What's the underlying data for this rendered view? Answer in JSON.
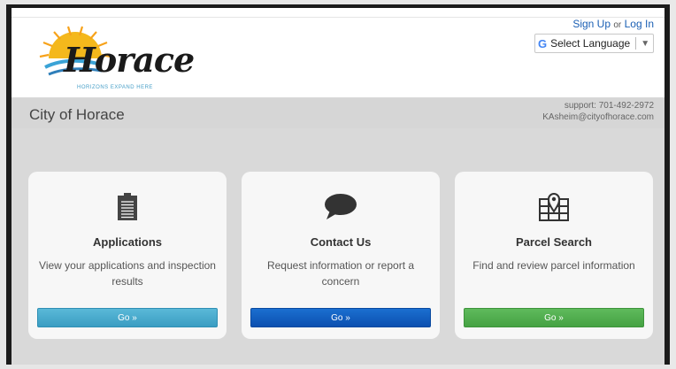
{
  "header": {
    "logo_word": "Horace",
    "logo_tagline": "HORIZONS EXPAND HERE",
    "signup_label": "Sign Up",
    "or_label": "or",
    "login_label": "Log In",
    "language_label": "Select Language"
  },
  "titlebar": {
    "city_name": "City of Horace",
    "support_phone": "support: 701-492-2972",
    "support_email": "KAsheim@cityofhorace.com"
  },
  "cards": [
    {
      "title": "Applications",
      "description": "View your applications and inspection results",
      "button": "Go »",
      "icon": "clipboard-icon",
      "color": "#44a7cd"
    },
    {
      "title": "Contact Us",
      "description": "Request information or report a concern",
      "button": "Go »",
      "icon": "speech-bubble-icon",
      "color": "#125fc0"
    },
    {
      "title": "Parcel Search",
      "description": "Find and review parcel information",
      "button": "Go »",
      "icon": "map-pin-icon",
      "color": "#52ae50"
    }
  ]
}
